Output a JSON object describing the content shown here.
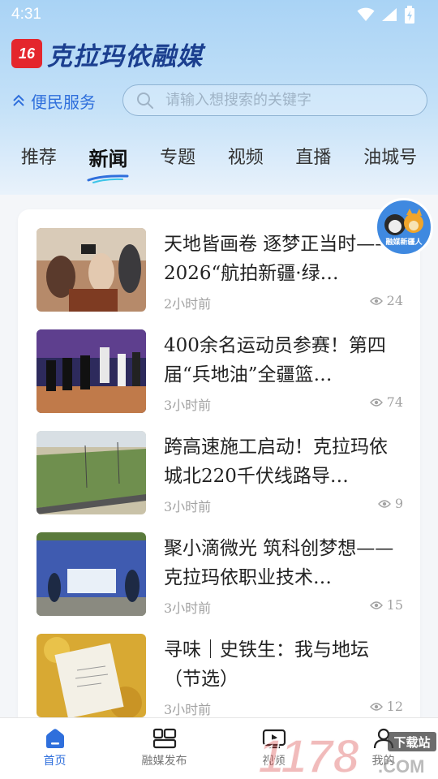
{
  "status_bar": {
    "time": "4:31"
  },
  "brand": {
    "logo_text": "16",
    "name": "克拉玛依融媒"
  },
  "service": {
    "label": "便民服务"
  },
  "search": {
    "placeholder": "请输入想搜索的关键字",
    "value": ""
  },
  "tabs": [
    {
      "label": "推荐",
      "active": false
    },
    {
      "label": "新闻",
      "active": true
    },
    {
      "label": "专题",
      "active": false
    },
    {
      "label": "视频",
      "active": false
    },
    {
      "label": "直播",
      "active": false
    },
    {
      "label": "油城号",
      "active": false
    }
  ],
  "news": [
    {
      "title": "天地皆画卷 逐梦正当时——2026“航拍新疆·绿…",
      "time": "2小时前",
      "views": "24"
    },
    {
      "title": "400余名运动员参赛！第四届“兵地油”全疆篮…",
      "time": "3小时前",
      "views": "74"
    },
    {
      "title": "跨高速施工启动！克拉玛依城北220千伏线路导…",
      "time": "3小时前",
      "views": "9"
    },
    {
      "title": "聚小滴微光 筑科创梦想——克拉玛依职业技术…",
      "time": "3小时前",
      "views": "15"
    },
    {
      "title": "寻味｜史铁生：我与地坛（节选）",
      "time": "3小时前",
      "views": "12"
    }
  ],
  "mascot": {
    "label": "融媒新疆人"
  },
  "bottom_nav": [
    {
      "label": "首页",
      "icon": "home-icon",
      "active": true
    },
    {
      "label": "融媒发布",
      "icon": "grid-icon",
      "active": false
    },
    {
      "label": "视频",
      "icon": "video-icon",
      "active": false
    },
    {
      "label": "我的",
      "icon": "user-icon",
      "active": false
    }
  ],
  "watermark": {
    "text": "1178",
    "suffix": ".COM",
    "badge": "下载站"
  },
  "colors": {
    "accent": "#2f6fdc",
    "brand_red": "#e4262d",
    "brand_blue": "#1b3f8f"
  }
}
